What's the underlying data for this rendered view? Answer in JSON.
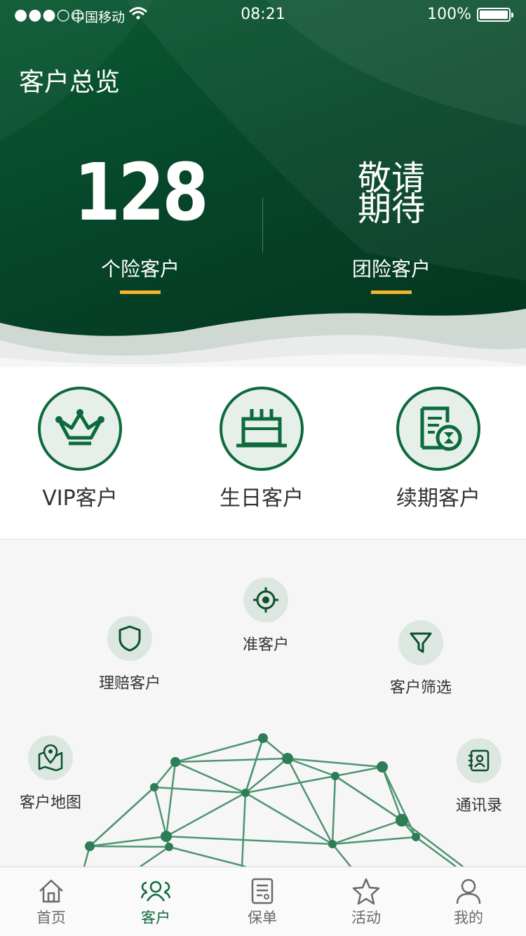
{
  "status_bar": {
    "signal": "●●●○○",
    "carrier": "中国移动",
    "time": "08:21",
    "battery": "100%"
  },
  "header": {
    "title": "客户总览",
    "stats": [
      {
        "value": "128",
        "label": "个险客户"
      },
      {
        "value": "敬请\n期待",
        "label": "团险客户"
      }
    ]
  },
  "quick_actions": [
    {
      "label": "VIP客户",
      "icon": "crown-icon"
    },
    {
      "label": "生日客户",
      "icon": "birthday-cake-icon"
    },
    {
      "label": "续期客户",
      "icon": "renewal-document-icon"
    }
  ],
  "features": [
    {
      "label": "准客户",
      "icon": "target-icon"
    },
    {
      "label": "理赔客户",
      "icon": "shield-icon"
    },
    {
      "label": "客户筛选",
      "icon": "filter-icon"
    },
    {
      "label": "客户地图",
      "icon": "map-pin-icon"
    },
    {
      "label": "通讯录",
      "icon": "contacts-icon"
    }
  ],
  "tabbar": {
    "active": "客户",
    "items": [
      {
        "label": "首页",
        "icon": "home-icon"
      },
      {
        "label": "客户",
        "icon": "customers-icon"
      },
      {
        "label": "保单",
        "icon": "policy-icon"
      },
      {
        "label": "活动",
        "icon": "star-icon"
      },
      {
        "label": "我的",
        "icon": "user-icon"
      }
    ]
  },
  "colors": {
    "brand_green": "#0d6a3c",
    "header_dark": "#03331d",
    "accent_yellow": "#f4b52a"
  }
}
